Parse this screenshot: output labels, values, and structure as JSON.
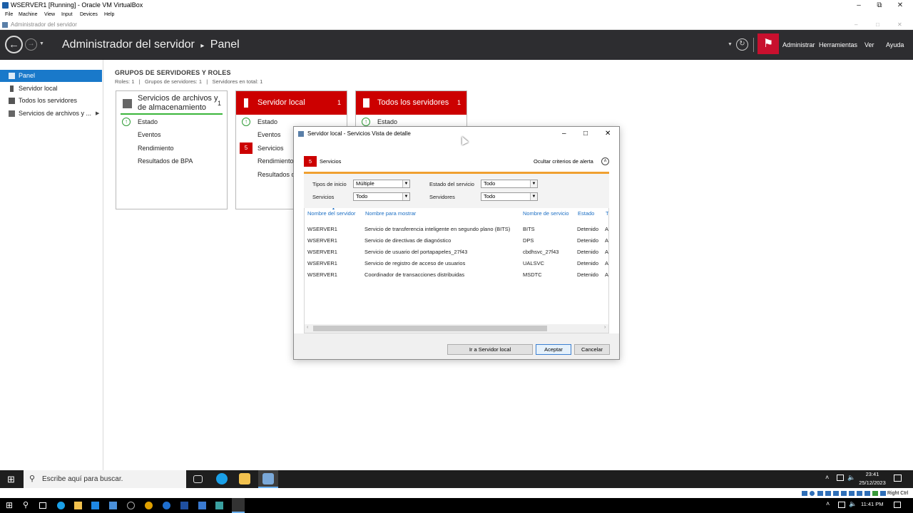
{
  "vbox": {
    "title": "WSERVER1 [Running] - Oracle VM VirtualBox",
    "menu": [
      "File",
      "Machine",
      "View",
      "Input",
      "Devices",
      "Help"
    ],
    "status_label": "Right Ctrl"
  },
  "server_manager": {
    "window_title": "Administrador del servidor",
    "header_app": "Administrador del servidor",
    "header_page": "Panel",
    "header_links": [
      "Administrar",
      "Herramientas",
      "Ver",
      "Ayuda"
    ]
  },
  "sidebar": {
    "items": [
      {
        "label": "Panel",
        "icon": "dashboard-icon"
      },
      {
        "label": "Servidor local",
        "icon": "server-icon"
      },
      {
        "label": "Todos los servidores",
        "icon": "servers-icon"
      },
      {
        "label": "Servicios de archivos y ...",
        "icon": "file-services-icon"
      }
    ]
  },
  "main": {
    "group_title": "GRUPOS DE SERVIDORES Y ROLES",
    "group_sub": "Roles: 1   |   Grupos de servidores: 1   |   Servidores en total: 1",
    "tiles": [
      {
        "name_line1": "Servicios de archivos y",
        "name_line2": "de almacenamiento",
        "count": "1",
        "rows": [
          "Estado",
          "Eventos",
          "Rendimiento",
          "Resultados de BPA"
        ]
      },
      {
        "name": "Servidor local",
        "count": "1",
        "rows": [
          "Estado",
          "Eventos",
          "Servicios",
          "Rendimiento",
          "Resultados d"
        ],
        "services_badge": "5"
      },
      {
        "name": "Todos los servidores",
        "count": "1",
        "rows": [
          "Estado"
        ]
      }
    ]
  },
  "dialog": {
    "title": "Servidor local - Servicios Vista de detalle",
    "badge": "5",
    "section_label": "Servicios",
    "hide_criteria": "Ocultar criterios de alerta",
    "filters": {
      "start_types_label": "Tipos de inicio",
      "start_types_value": "Múltiple",
      "service_state_label": "Estado del servicio",
      "service_state_value": "Todo",
      "services_label": "Servicios",
      "services_value": "Todo",
      "servers_label": "Servidores",
      "servers_value": "Todo"
    },
    "columns": [
      "Nombre del servidor",
      "Nombre para mostrar",
      "Nombre de servicio",
      "Estado",
      "Ti"
    ],
    "rows": [
      [
        "WSERVER1",
        "Servicio de transferencia inteligente en segundo plano (BITS)",
        "BITS",
        "Detenido",
        "Au"
      ],
      [
        "WSERVER1",
        "Servicio de directivas de diagnóstico",
        "DPS",
        "Detenido",
        "Au"
      ],
      [
        "WSERVER1",
        "Servicio de usuario del portapapeles_27f43",
        "cbdhsvc_27f43",
        "Detenido",
        "Au"
      ],
      [
        "WSERVER1",
        "Servicio de registro de acceso de usuarios",
        "UALSVC",
        "Detenido",
        "Au"
      ],
      [
        "WSERVER1",
        "Coordinador de transacciones distribuidas",
        "MSDTC",
        "Detenido",
        "Au"
      ]
    ],
    "buttons": {
      "go_local": "Ir a Servidor local",
      "accept": "Aceptar",
      "cancel": "Cancelar"
    }
  },
  "taskbar": {
    "search_placeholder": "Escribe aquí para buscar.",
    "time": "23:41",
    "date": "25/12/2023"
  },
  "host_taskbar": {
    "time": "11:41 PM"
  },
  "colors": {
    "accent_blue": "#1979ca",
    "alert_red": "#c8102e",
    "ok_green": "#2e9c36",
    "header_dark": "#2d2d30",
    "alert_bar_orange": "#f0a030"
  }
}
